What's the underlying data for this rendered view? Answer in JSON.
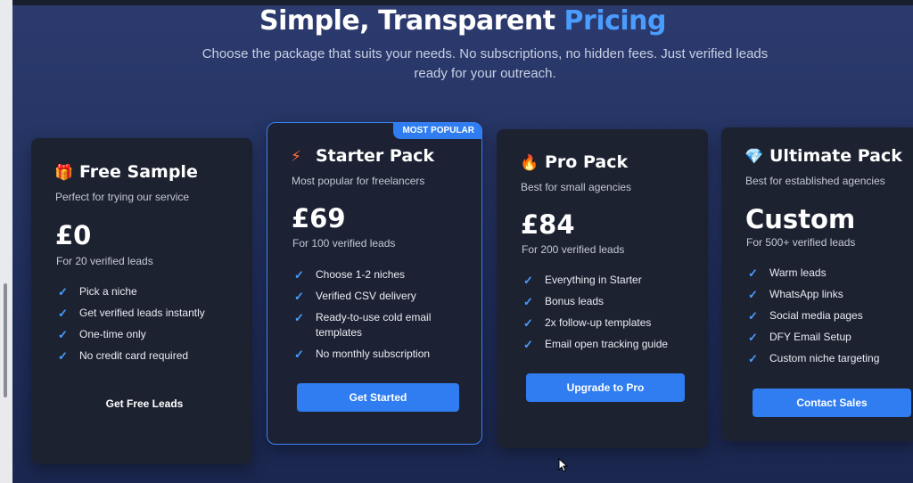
{
  "header": {
    "title_main": "Simple, Transparent",
    "title_accent": "Pricing",
    "subtitle": "Choose the package that suits your needs. No subscriptions, no hidden fees. Just verified leads ready for your outreach."
  },
  "colors": {
    "accent": "#4a9dff",
    "button": "#2f7df0",
    "card": "#1d2231"
  },
  "plans": [
    {
      "icon": "gift-icon",
      "icon_glyph": "🎁",
      "name": "Free Sample",
      "description": "Perfect for trying our service",
      "price": "£0",
      "for": "For 20 verified leads",
      "features": [
        "Pick a niche",
        "Get verified leads instantly",
        "One-time only",
        "No credit card required"
      ],
      "cta": "Get Free Leads"
    },
    {
      "icon": "lightning-icon",
      "icon_glyph": "⚡",
      "badge": "MOST POPULAR",
      "name": "Starter Pack",
      "description": "Most popular for freelancers",
      "price": "£69",
      "for": "For 100 verified leads",
      "features": [
        "Choose 1-2 niches",
        "Verified CSV delivery",
        "Ready-to-use cold email templates",
        "No monthly subscription"
      ],
      "cta": "Get Started"
    },
    {
      "icon": "fire-icon",
      "icon_glyph": "🔥",
      "name": "Pro Pack",
      "description": "Best for small agencies",
      "price": "£84",
      "for": "For 200 verified leads",
      "features": [
        "Everything in Starter",
        "Bonus leads",
        "2x follow-up templates",
        "Email open tracking guide"
      ],
      "cta": "Upgrade to Pro"
    },
    {
      "icon": "diamond-icon",
      "icon_glyph": "💎",
      "name": "Ultimate Pack",
      "description": "Best for established agencies",
      "price": "Custom",
      "for": "For 500+ verified leads",
      "features": [
        "Warm leads",
        "WhatsApp links",
        "Social media pages",
        "DFY Email Setup",
        "Custom niche targeting"
      ],
      "cta": "Contact Sales"
    }
  ],
  "check_glyph": "✓"
}
